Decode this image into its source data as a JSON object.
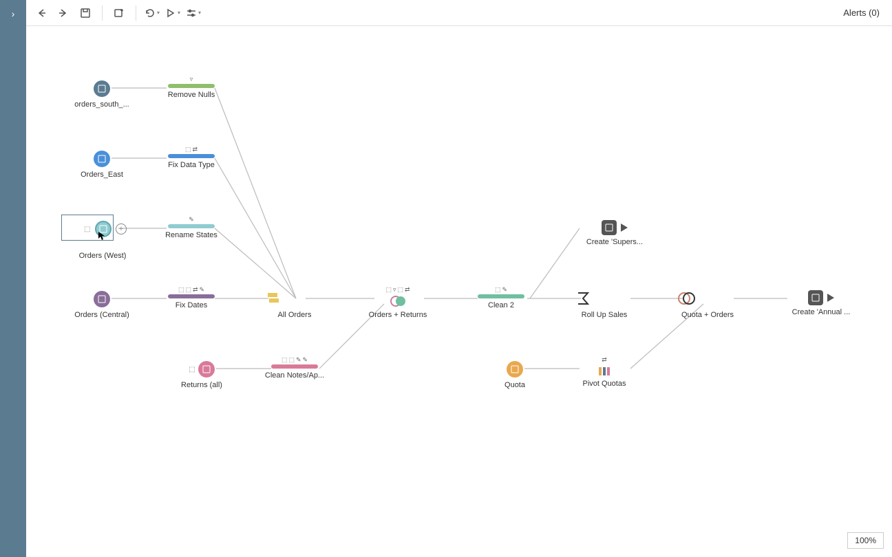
{
  "toolbar": {
    "alerts_label": "Alerts (0)"
  },
  "zoom": "100%",
  "nodes": {
    "orders_south": {
      "label": "orders_south_...",
      "color": "#5b7b91"
    },
    "orders_east": {
      "label": "Orders_East",
      "color": "#4a90d9"
    },
    "orders_west": {
      "label": "Orders (West)",
      "color": "#8fccd0"
    },
    "orders_central": {
      "label": "Orders (Central)",
      "color": "#8a6d99"
    },
    "returns_all": {
      "label": "Returns (all)",
      "color": "#d97a98"
    },
    "quota": {
      "label": "Quota",
      "color": "#e9a84f"
    },
    "remove_nulls": {
      "label": "Remove Nulls",
      "color": "#8fbf6b",
      "badges": [
        "▿"
      ]
    },
    "fix_data_type": {
      "label": "Fix Data Type",
      "color": "#4a90d9",
      "badges": [
        "⬚",
        "⇄"
      ]
    },
    "rename_states": {
      "label": "Rename States",
      "color": "#8fccd0",
      "badges": [
        "✎"
      ]
    },
    "fix_dates": {
      "label": "Fix Dates",
      "color": "#8a6d99",
      "badges": [
        "⬚",
        "⬚",
        "⇄",
        "✎"
      ]
    },
    "clean_notes": {
      "label": "Clean Notes/Ap...",
      "color": "#d97a98",
      "badges": [
        "⬚",
        "⬚",
        "✎",
        "✎"
      ]
    },
    "clean2": {
      "label": "Clean 2",
      "color": "#6fbfa0",
      "badges": [
        "⬚",
        "✎"
      ]
    },
    "all_orders": {
      "label": "All Orders"
    },
    "orders_returns": {
      "label": "Orders + Returns",
      "badges": [
        "⬚",
        "▿",
        "⬚",
        "⇄"
      ]
    },
    "roll_up_sales": {
      "label": "Roll Up Sales"
    },
    "quota_orders": {
      "label": "Quota + Orders"
    },
    "pivot_quotas": {
      "label": "Pivot Quotas",
      "badges": [
        "⇄"
      ]
    },
    "create_supers": {
      "label": "Create 'Supers..."
    },
    "create_annual": {
      "label": "Create 'Annual ..."
    }
  }
}
